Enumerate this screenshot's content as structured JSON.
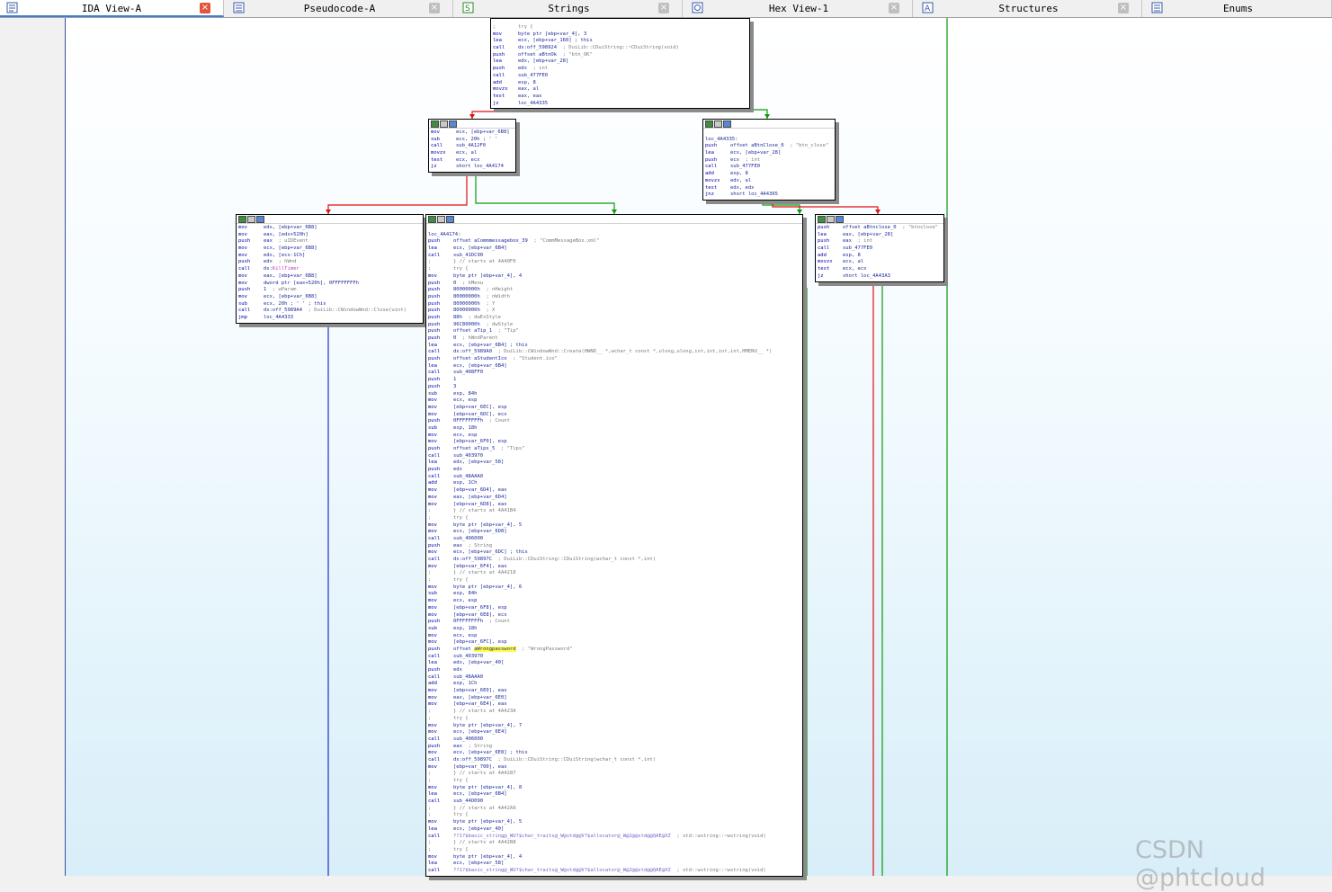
{
  "tabs": [
    {
      "label": "IDA View-A",
      "icon": "ida-view-icon",
      "active": true,
      "closable": true
    },
    {
      "label": "Pseudocode-A",
      "icon": "pseudocode-icon",
      "active": false,
      "closable": true
    },
    {
      "label": "Strings",
      "icon": "strings-icon",
      "active": false,
      "closable": true
    },
    {
      "label": "Hex View-1",
      "icon": "hex-view-icon",
      "active": false,
      "closable": true
    },
    {
      "label": "Structures",
      "icon": "structures-icon",
      "active": false,
      "closable": true
    },
    {
      "label": "Enums",
      "icon": "enums-icon",
      "active": false,
      "closable": false
    }
  ],
  "close_glyph": "×",
  "nodes": [
    {
      "id": "top",
      "lines": [
        [
          ";",
          "try {",
          ""
        ],
        [
          "mov",
          "byte ptr [ebp+var_4], 3",
          ""
        ],
        [
          "lea",
          "ecx, [ebp+var_160] ; this",
          ""
        ],
        [
          "call",
          "ds:off_598924",
          "; DuiLib::CDuiString::~CDuiString(void)"
        ],
        [
          "push",
          "offset aBtnOk",
          "; \"btn_OK\""
        ],
        [
          "lea",
          "edx, [ebp+var_28]",
          ""
        ],
        [
          "push",
          "edx",
          "; int"
        ],
        [
          "call",
          "sub_477FE0",
          ""
        ],
        [
          "add",
          "esp, 8",
          ""
        ],
        [
          "movzx",
          "eax, al",
          ""
        ],
        [
          "test",
          "eax, eax",
          ""
        ],
        [
          "jz",
          "loc_4A4335",
          ""
        ]
      ]
    },
    {
      "id": "mid-left",
      "lines": [
        [
          "mov",
          "ecx, [ebp+var_6B8]",
          ""
        ],
        [
          "sub",
          "ecx, 20h ; ' '",
          ""
        ],
        [
          "call",
          "sub_4A12F0",
          ""
        ],
        [
          "movzx",
          "ecx, al",
          ""
        ],
        [
          "test",
          "ecx, ecx",
          ""
        ],
        [
          "jz",
          "short loc_4A4174",
          ""
        ]
      ]
    },
    {
      "id": "mid-right",
      "lines": [
        [
          "",
          "",
          ""
        ],
        [
          "loc_4A4335:",
          "",
          ""
        ],
        [
          "push",
          "offset aBtnClose_0",
          "; \"btn_close\""
        ],
        [
          "lea",
          "ecx, [ebp+var_28]",
          ""
        ],
        [
          "push",
          "ecx",
          "; int"
        ],
        [
          "call",
          "sub_477FE0",
          ""
        ],
        [
          "add",
          "esp, 8",
          ""
        ],
        [
          "movzx",
          "edx, al",
          ""
        ],
        [
          "test",
          "edx, edx",
          ""
        ],
        [
          "jnz",
          "short loc_4A4365",
          ""
        ]
      ]
    },
    {
      "id": "killtimer",
      "lines": [
        [
          "mov",
          "edx, [ebp+var_6B8]",
          ""
        ],
        [
          "mov",
          "eax, [edx+520h]",
          ""
        ],
        [
          "push",
          "eax",
          "; uIDEvent"
        ],
        [
          "mov",
          "ecx, [ebp+var_6B8]",
          ""
        ],
        [
          "mov",
          "edx, [ecx-1Ch]",
          ""
        ],
        [
          "push",
          "edx",
          "; hWnd"
        ],
        [
          "call",
          "ds:KillTimer",
          ""
        ],
        [
          "mov",
          "eax, [ebp+var_6B8]",
          ""
        ],
        [
          "mov",
          "dword ptr [eax+520h], 0FFFFFFFFh",
          ""
        ],
        [
          "push",
          "1",
          "; wParam"
        ],
        [
          "mov",
          "ecx, [ebp+var_6B8]",
          ""
        ],
        [
          "sub",
          "ecx, 20h ; ' ' ; this",
          ""
        ],
        [
          "call",
          "ds:off_5989A4",
          "; DuiLib::CWindowWnd::Close(uint)"
        ],
        [
          "jmp",
          "loc_4A4333",
          ""
        ]
      ]
    },
    {
      "id": "btnclose",
      "lines": [
        [
          "push",
          "offset aBtnclose_0",
          "; \"btnclose\""
        ],
        [
          "lea",
          "eax, [ebp+var_28]",
          ""
        ],
        [
          "push",
          "eax",
          "; int"
        ],
        [
          "call",
          "sub_477FE0",
          ""
        ],
        [
          "add",
          "esp, 8",
          ""
        ],
        [
          "movzx",
          "ecx, al",
          ""
        ],
        [
          "test",
          "ecx, ecx",
          ""
        ],
        [
          "jz",
          "short loc_4A43A3",
          ""
        ]
      ]
    },
    {
      "id": "big",
      "lines": [
        [
          "",
          "",
          ""
        ],
        [
          "loc_4A4174:",
          "",
          ""
        ],
        [
          "push",
          "offset aCommmessagebox_39",
          "; \"CommMessageBox.xml\""
        ],
        [
          "lea",
          "ecx, [ebp+var_6B4]",
          ""
        ],
        [
          "call",
          "sub_41DC90",
          ""
        ],
        [
          ";",
          "} // starts at 4A40F0",
          ""
        ],
        [
          ";",
          "try {",
          ""
        ],
        [
          "mov",
          "byte ptr [ebp+var_4], 4",
          ""
        ],
        [
          "push",
          "0",
          "; hMenu"
        ],
        [
          "push",
          "80000000h",
          "; nHeight"
        ],
        [
          "push",
          "80000000h",
          "; nWidth"
        ],
        [
          "push",
          "80000000h",
          "; Y"
        ],
        [
          "push",
          "80000000h",
          "; X"
        ],
        [
          "push",
          "88h",
          "; dwExStyle"
        ],
        [
          "push",
          "96C80000h",
          "; dwStyle"
        ],
        [
          "push",
          "offset aTip_1",
          "; \"Tip\""
        ],
        [
          "push",
          "0",
          "; hWndParent"
        ],
        [
          "lea",
          "ecx, [ebp+var_6B4] ; this",
          ""
        ],
        [
          "call",
          "ds:off_5989A0",
          "; DuiLib::CWindowWnd::Create(HWND__ *,wchar_t const *,ulong,ulong,int,int,int,int,HMENU__ *)"
        ],
        [
          "push",
          "offset aStudentIco",
          "; \"Student.ico\""
        ],
        [
          "lea",
          "ecx, [ebp+var_6B4]",
          ""
        ],
        [
          "call",
          "sub_408FF0",
          ""
        ],
        [
          "push",
          "1",
          ""
        ],
        [
          "push",
          "3",
          ""
        ],
        [
          "sub",
          "esp, 84h",
          ""
        ],
        [
          "mov",
          "ecx, esp",
          ""
        ],
        [
          "mov",
          "[ebp+var_6EC], esp",
          ""
        ],
        [
          "mov",
          "[ebp+var_6DC], ecx",
          ""
        ],
        [
          "push",
          "0FFFFFFFFh",
          "; Count"
        ],
        [
          "sub",
          "esp, 18h",
          ""
        ],
        [
          "mov",
          "ecx, esp",
          ""
        ],
        [
          "mov",
          "[ebp+var_6F0], esp",
          ""
        ],
        [
          "push",
          "offset aTips_5",
          "; \"Tips\""
        ],
        [
          "call",
          "sub_403970",
          ""
        ],
        [
          "lea",
          "edx, [ebp+var_58]",
          ""
        ],
        [
          "push",
          "edx",
          ""
        ],
        [
          "call",
          "sub_48AAA0",
          ""
        ],
        [
          "add",
          "esp, 1Ch",
          ""
        ],
        [
          "mov",
          "[ebp+var_6D4], eax",
          ""
        ],
        [
          "mov",
          "eax, [ebp+var_6D4]",
          ""
        ],
        [
          "mov",
          "[ebp+var_6D8], eax",
          ""
        ],
        [
          ";",
          "} // starts at 4A41B4",
          ""
        ],
        [
          ";",
          "try {",
          ""
        ],
        [
          "mov",
          "byte ptr [ebp+var_4], 5",
          ""
        ],
        [
          "mov",
          "ecx, [ebp+var_6D8]",
          ""
        ],
        [
          "call",
          "sub_406000",
          ""
        ],
        [
          "push",
          "eax",
          "; String"
        ],
        [
          "mov",
          "ecx, [ebp+var_6DC] ; this",
          ""
        ],
        [
          "call",
          "ds:off_59897C",
          "; DuiLib::CDuiString::CDuiString(wchar_t const *,int)"
        ],
        [
          "mov",
          "[ebp+var_6F4], eax",
          ""
        ],
        [
          ";",
          "} // starts at 4A4218",
          ""
        ],
        [
          ";",
          "try {",
          ""
        ],
        [
          "mov",
          "byte ptr [ebp+var_4], 6",
          ""
        ],
        [
          "sub",
          "esp, 84h",
          ""
        ],
        [
          "mov",
          "ecx, esp",
          ""
        ],
        [
          "mov",
          "[ebp+var_6F8], esp",
          ""
        ],
        [
          "mov",
          "[ebp+var_6E8], ecx",
          ""
        ],
        [
          "push",
          "0FFFFFFFFh",
          "; Count"
        ],
        [
          "sub",
          "esp, 18h",
          ""
        ],
        [
          "mov",
          "ecx, esp",
          ""
        ],
        [
          "mov",
          "[ebp+var_6FC], esp",
          ""
        ],
        [
          "push",
          "offset aWrongpassword",
          "; \"WrongPassword\""
        ],
        [
          "call",
          "sub_403970",
          ""
        ],
        [
          "lea",
          "edx, [ebp+var_40]",
          ""
        ],
        [
          "push",
          "edx",
          ""
        ],
        [
          "call",
          "sub_48AAA0",
          ""
        ],
        [
          "add",
          "esp, 1Ch",
          ""
        ],
        [
          "mov",
          "[ebp+var_6E0], eax",
          ""
        ],
        [
          "mov",
          "eax, [ebp+var_6E0]",
          ""
        ],
        [
          "mov",
          "[ebp+var_6E4], eax",
          ""
        ],
        [
          ";",
          "} // starts at 4A423A",
          ""
        ],
        [
          ";",
          "try {",
          ""
        ],
        [
          "mov",
          "byte ptr [ebp+var_4], 7",
          ""
        ],
        [
          "mov",
          "ecx, [ebp+var_6E4]",
          ""
        ],
        [
          "call",
          "sub_406000",
          ""
        ],
        [
          "push",
          "eax",
          "; String"
        ],
        [
          "mov",
          "ecx, [ebp+var_6E8] ; this",
          ""
        ],
        [
          "call",
          "ds:off_59897C",
          "; DuiLib::CDuiString::CDuiString(wchar_t const *,int)"
        ],
        [
          "mov",
          "[ebp+var_700], eax",
          ""
        ],
        [
          ";",
          "} // starts at 4A4287",
          ""
        ],
        [
          ";",
          "try {",
          ""
        ],
        [
          "mov",
          "byte ptr [ebp+var_4], 8",
          ""
        ],
        [
          "lea",
          "ecx, [ebp+var_6B4]",
          ""
        ],
        [
          "call",
          "sub_44D090",
          ""
        ],
        [
          ";",
          "} // starts at 4A42A9",
          ""
        ],
        [
          ";",
          "try {",
          ""
        ],
        [
          "mov",
          "byte ptr [ebp+var_4], 5",
          ""
        ],
        [
          "lea",
          "ecx, [ebp+var_40]",
          ""
        ],
        [
          "call",
          "??1?$basic_string@_WU?$char_traits@_W@std@@V?$allocator@_W@2@@std@@QAE@XZ",
          "; std::wstring::~wstring(void)"
        ],
        [
          ";",
          "} // starts at 4A42B8",
          ""
        ],
        [
          ";",
          "try {",
          ""
        ],
        [
          "mov",
          "byte ptr [ebp+var_4], 4",
          ""
        ],
        [
          "lea",
          "ecx, [ebp+var_58]",
          ""
        ],
        [
          "call",
          "??1?$basic_string@_WU?$char_traits@_W@std@@V?$allocator@_W@2@@std@@QAE@XZ",
          "; std::wstring::~wstring(void)"
        ]
      ]
    }
  ],
  "highlight_word": "aWrongpassword",
  "watermark": "CSDN @phtcloud",
  "colors": {
    "edge_true": "#0a9a0a",
    "edge_false": "#e01010",
    "edge_uncond": "#2030d0",
    "tab_accent": "#3c7fd6"
  }
}
